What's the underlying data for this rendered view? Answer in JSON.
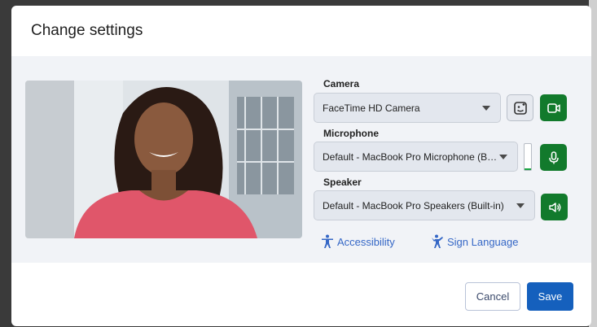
{
  "dialog": {
    "title": "Change settings"
  },
  "camera": {
    "label": "Camera",
    "selected": "FaceTime HD Camera"
  },
  "microphone": {
    "label": "Microphone",
    "selected": "Default - MacBook Pro Microphone (Bu…",
    "level": 0.05
  },
  "speaker": {
    "label": "Speaker",
    "selected": "Default - MacBook Pro Speakers (Built-in)"
  },
  "links": {
    "accessibility": "Accessibility",
    "sign_language": "Sign Language"
  },
  "footer": {
    "cancel": "Cancel",
    "save": "Save"
  },
  "icons": {
    "effects": "background-effects-icon",
    "video": "video-camera-icon",
    "mic": "microphone-icon",
    "speaker": "speaker-icon",
    "accessibility": "accessibility-person-icon",
    "sign_language": "sign-language-icon"
  },
  "colors": {
    "green": "#127a2c",
    "primary": "#1560bd",
    "link": "#3567c6"
  }
}
